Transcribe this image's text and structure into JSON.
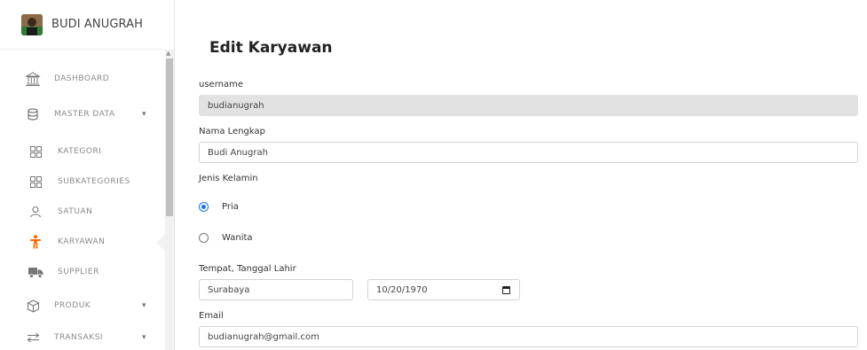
{
  "sidebar": {
    "user_name": "BUDI ANUGRAH",
    "items": [
      {
        "label": "DASHBOARD",
        "icon": "bank-icon"
      },
      {
        "label": "MASTER DATA",
        "icon": "database-icon"
      },
      {
        "label": "KATEGORI",
        "icon": "grid-icon"
      },
      {
        "label": "SUBKATEGORIES",
        "icon": "grid-icon"
      },
      {
        "label": "SATUAN",
        "icon": "user-icon"
      },
      {
        "label": "KARYAWAN",
        "icon": "person-icon"
      },
      {
        "label": "SUPPLIER",
        "icon": "truck-icon"
      },
      {
        "label": "PRODUK",
        "icon": "box-icon"
      },
      {
        "label": "TRANSAKSI",
        "icon": "arrows-icon"
      }
    ],
    "active_color": "#ff6b00"
  },
  "form": {
    "title": "Edit Karyawan",
    "username_label": "username",
    "username_value": "budianugrah",
    "fullname_label": "Nama Lengkap",
    "fullname_value": "Budi Anugrah",
    "gender_label": "Jenis Kelamin",
    "gender_options": [
      "Pria",
      "Wanita"
    ],
    "gender_selected": "Pria",
    "birth_label": "Tempat, Tanggal Lahir",
    "birth_place": "Surabaya",
    "birth_date": "10/20/1970",
    "email_label": "Email",
    "email_value": "budianugrah@gmail.com"
  }
}
